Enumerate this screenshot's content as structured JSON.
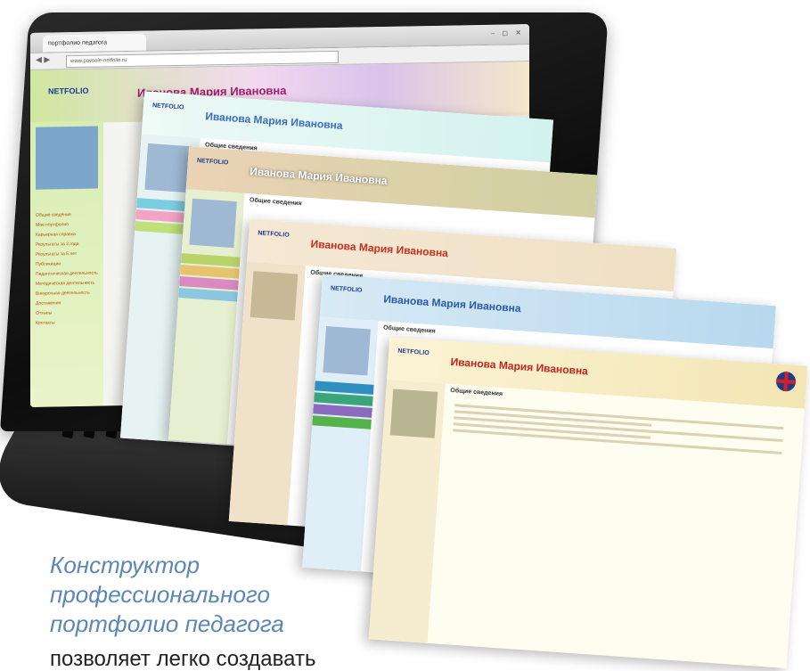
{
  "browser": {
    "tab_title": "портфолио педагога",
    "window_buttons": "– ◻ ✕",
    "address": "www.pavsole-netfolio.ru"
  },
  "site": {
    "logo_text": "NETFOLIO",
    "owner_name": "Иванова Мария Ивановна",
    "sidebar_links": [
      "Общие сведения",
      "Мое портфолио",
      "Карьерная справка",
      "Результаты за 3 года",
      "Результаты за 5 лет",
      "Публикации",
      "Педагогическая деятельность",
      "Методическая деятельность",
      "Внеурочная деятельность",
      "Достижения",
      "Отзывы",
      "Контакты"
    ]
  },
  "cards": [
    {
      "title": "Иванова Мария Ивановна",
      "section": "Общие сведения",
      "logo": "NETFOLIO"
    },
    {
      "title": "Иванова Мария Ивановна",
      "section": "Общие сведения",
      "logo": "NETFOLIO"
    },
    {
      "title": "Иванова Мария Ивановна",
      "section": "Общие сведения",
      "logo": "NETFOLIO"
    },
    {
      "title": "Иванова Мария Ивановна",
      "section": "Общие сведения",
      "logo": "NETFOLIO"
    },
    {
      "title": "Иванова Мария Ивановна",
      "section": "Общие сведения",
      "logo": "NETFOLIO"
    }
  ],
  "caption": {
    "line1": "Конструктор",
    "line2": "профессионального",
    "line3": "портфолио педагога",
    "line4": "позволяет легко создавать"
  },
  "colors": {
    "caption": "#5a86b8",
    "accent_red": "#c0261c",
    "accent_blue": "#2a5aa8"
  }
}
